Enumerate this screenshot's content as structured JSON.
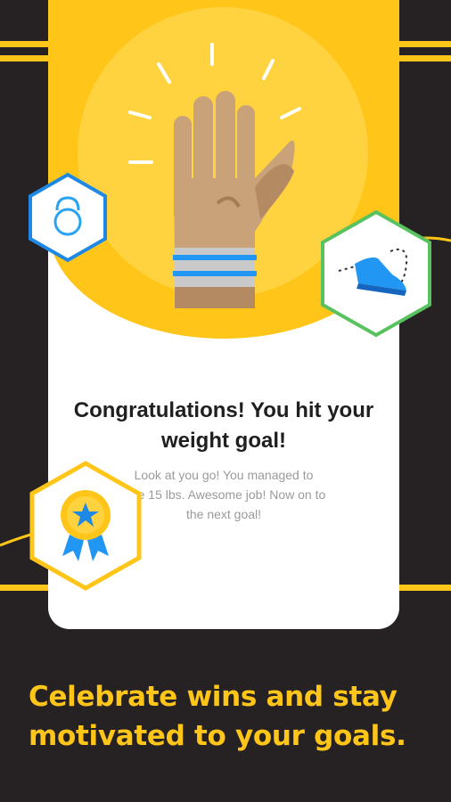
{
  "card": {
    "title_line1": "Congratulations! You hit",
    "title_line2": "your weight goal!",
    "body_line1": "Look at you go! You managed to",
    "body_line2": "lose 15 lbs. Awesome job! Now on to",
    "body_line3": "the next goal!"
  },
  "badges": {
    "kettlebell": "kettlebell-icon",
    "sneaker": "sneaker-icon",
    "award": "award-ribbon-icon"
  },
  "caption": {
    "line1": "Celebrate wins and stay",
    "line2": "motivated to your goals."
  },
  "colors": {
    "background": "#262223",
    "accent_yellow": "#FFC619",
    "badge_blue": "#1E88E5",
    "badge_green": "#58C25E"
  }
}
